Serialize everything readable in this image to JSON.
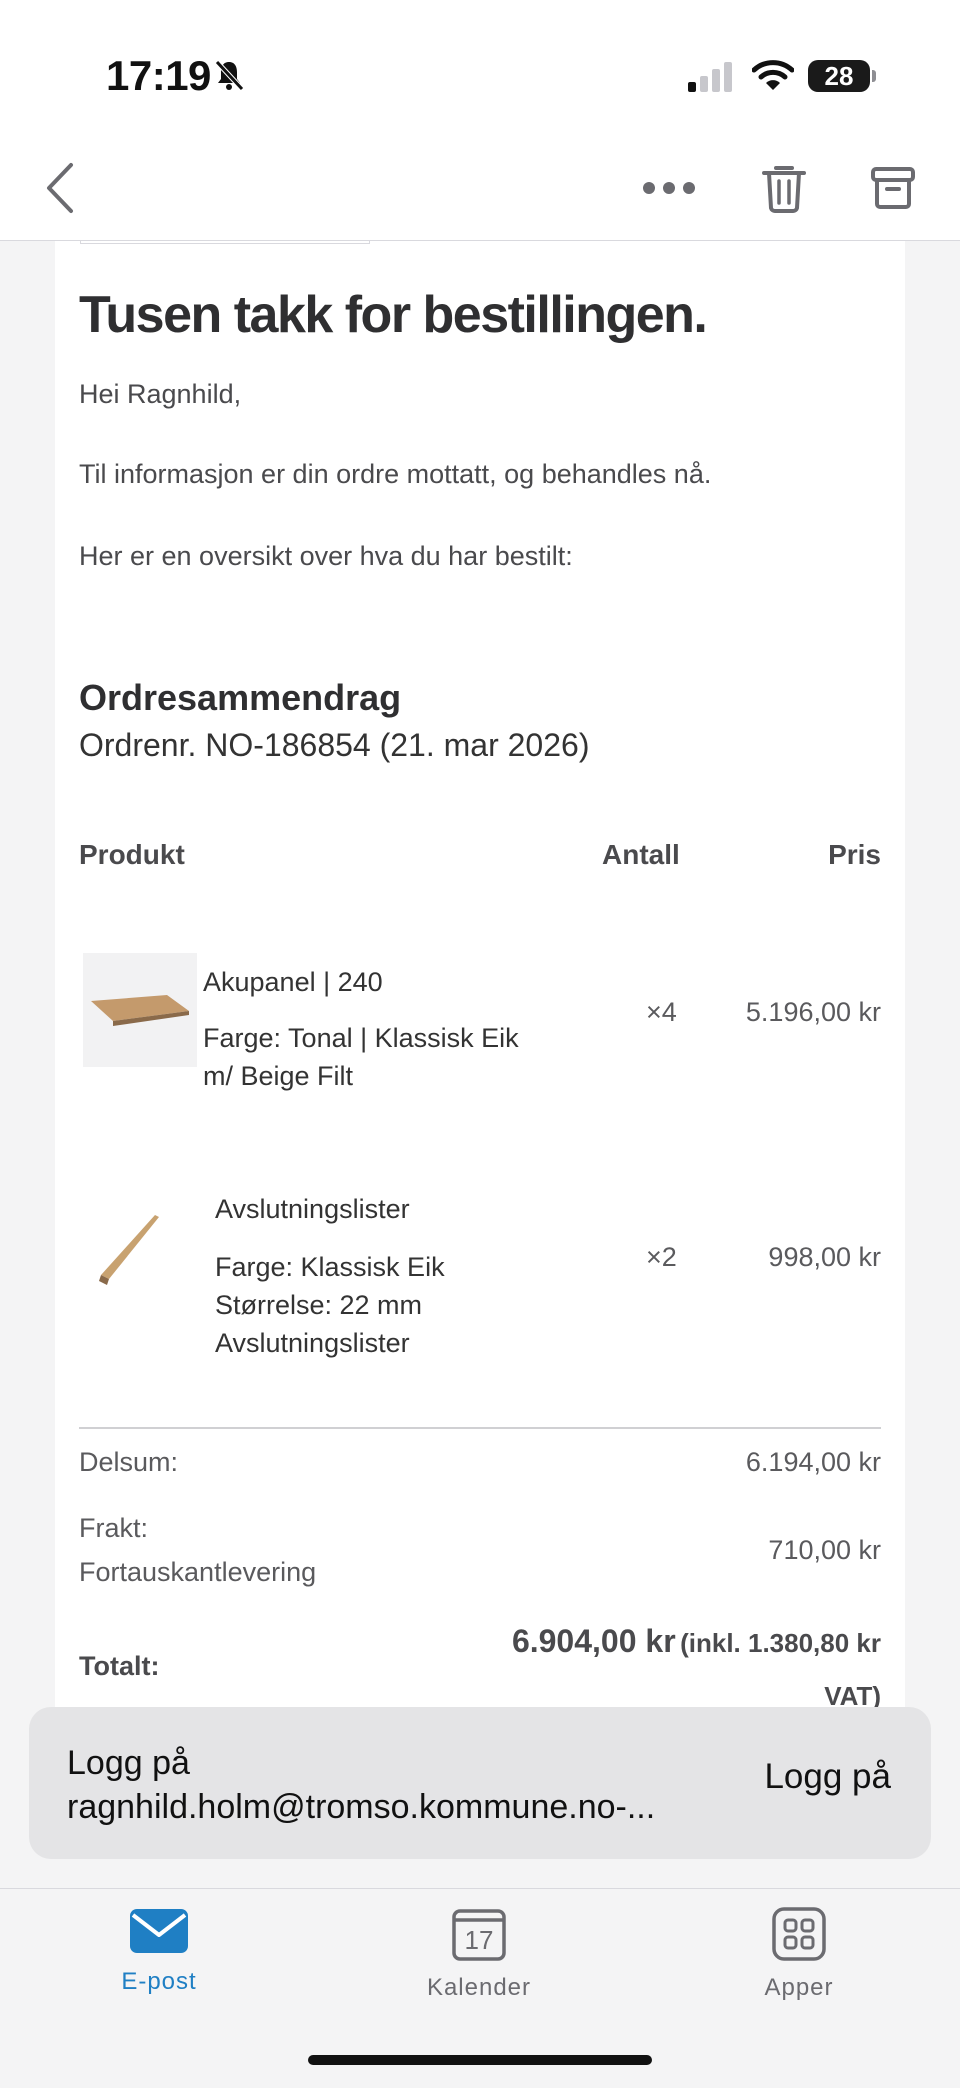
{
  "status_bar": {
    "time": "17:19",
    "battery": "28"
  },
  "toolbar": {
    "back_icon": "chevron-left-icon",
    "more_icon": "more-horizontal-icon",
    "trash_icon": "trash-icon",
    "archive_icon": "archive-icon"
  },
  "email": {
    "heading": "Tusen takk for bestillingen.",
    "greeting": "Hei Ragnhild,",
    "info": "Til informasjon er din ordre mottatt, og behandles nå.",
    "overview": "Her er en oversikt over hva du har bestilt:",
    "summary_title": "Ordresammendrag",
    "order_number": "Ordrenr. NO-186854 (21. mar 2026)",
    "columns": {
      "product": "Produkt",
      "quantity": "Antall",
      "price": "Pris"
    },
    "items": [
      {
        "name": "Akupanel | 240",
        "details": [
          "Farge: Tonal | Klassisk Eik",
          "m/ Beige Filt"
        ],
        "quantity": "×4",
        "price": "5.196,00 kr"
      },
      {
        "name": "Avslutningslister",
        "details": [
          "Farge: Klassisk Eik",
          "Størrelse: 22 mm",
          "Avslutningslister"
        ],
        "quantity": "×2",
        "price": "998,00 kr"
      }
    ],
    "subtotal_label": "Delsum:",
    "subtotal_value": "6.194,00 kr",
    "shipping_label": "Frakt:",
    "shipping_method": "Fortauskantlevering",
    "shipping_value": "710,00 kr",
    "total_label": "Totalt:",
    "total_value": "6.904,00 kr",
    "total_vat_line1": "(inkl. 1.380,80 kr",
    "total_vat_line2": "VAT)"
  },
  "signin_banner": {
    "line1": "Logg på",
    "line2": "ragnhild.holm@tromso.kommune.no-...",
    "button": "Logg på"
  },
  "tabbar": {
    "tabs": [
      {
        "label": "E-post",
        "icon": "mail-icon",
        "active": true
      },
      {
        "label": "Kalender",
        "icon": "calendar-icon",
        "date": "17",
        "active": false
      },
      {
        "label": "Apper",
        "icon": "apps-grid-icon",
        "active": false
      }
    ]
  },
  "colors": {
    "accent": "#1f7fc4",
    "icon_gray": "#8e8e93",
    "text_dark": "#2f2f31"
  }
}
